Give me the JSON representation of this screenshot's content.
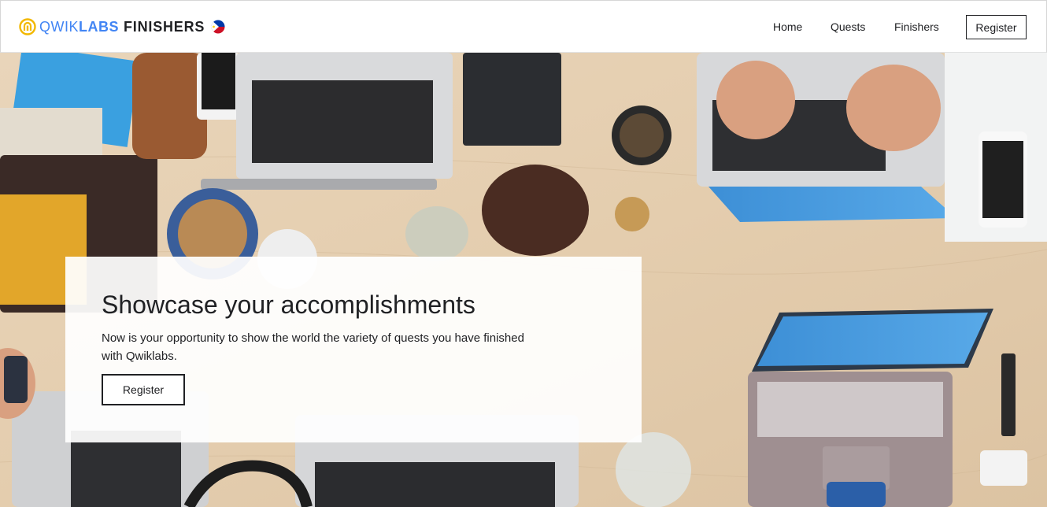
{
  "brand": {
    "part1": "QWIK",
    "part2": "LABS",
    "part3": "FINISHERS",
    "icon": "qwiklabs-logo-icon",
    "flag": "philippines-flag-icon"
  },
  "nav": {
    "home": "Home",
    "quests": "Quests",
    "finishers": "Finishers",
    "register": "Register"
  },
  "hero": {
    "background": "desk-with-laptops-photo",
    "title": "Showcase your accomplishments",
    "text": "Now is your opportunity to show the world the variety of quests you have finished with Qwiklabs.",
    "register": "Register"
  },
  "colors": {
    "brand_blue": "#4285f4",
    "brand_yellow": "#f2b800",
    "text": "#202124"
  }
}
